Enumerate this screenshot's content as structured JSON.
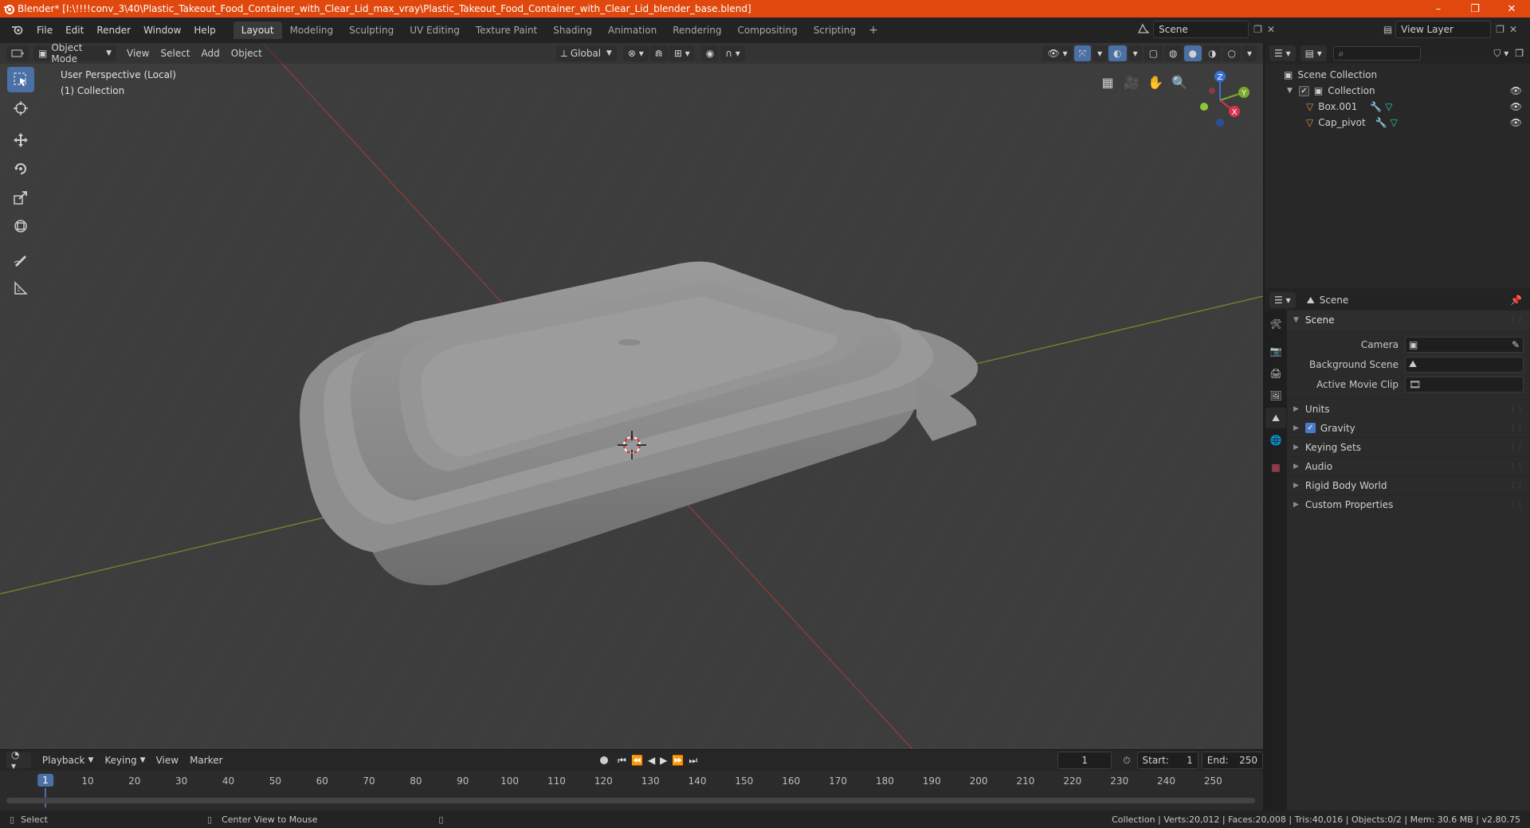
{
  "window": {
    "title": "Blender* [I:\\!!!!conv_3\\40\\Plastic_Takeout_Food_Container_with_Clear_Lid_max_vray\\Plastic_Takeout_Food_Container_with_Clear_Lid_blender_base.blend]",
    "controls": [
      "–",
      "❐",
      "✕"
    ]
  },
  "menu": [
    "File",
    "Edit",
    "Render",
    "Window",
    "Help"
  ],
  "workspaces": [
    "Layout",
    "Modeling",
    "Sculpting",
    "UV Editing",
    "Texture Paint",
    "Shading",
    "Animation",
    "Rendering",
    "Compositing",
    "Scripting"
  ],
  "active_workspace": "Layout",
  "scene_selector": "Scene",
  "view_layer_selector": "View Layer",
  "viewport": {
    "mode": "Object Mode",
    "menus": [
      "View",
      "Select",
      "Add",
      "Object"
    ],
    "transform_orientation": "Global",
    "info_line1": "User Perspective (Local)",
    "info_line2": "(1) Collection"
  },
  "gizmo": {
    "z": "Z",
    "y": "Y",
    "x": "X"
  },
  "timeline": {
    "menus": [
      "Playback",
      "Keying",
      "View",
      "Marker"
    ],
    "current_frame": "1",
    "start_label": "Start:",
    "start": "1",
    "end_label": "End:",
    "end": "250",
    "ticks": [
      "1",
      "10",
      "20",
      "30",
      "40",
      "50",
      "60",
      "70",
      "80",
      "90",
      "100",
      "110",
      "120",
      "130",
      "140",
      "150",
      "160",
      "170",
      "180",
      "190",
      "200",
      "210",
      "220",
      "230",
      "240",
      "250"
    ]
  },
  "statusbar": {
    "left_action": "Select",
    "middle_action": "Center View to Mouse",
    "stats": "Collection | Verts:20,012 | Faces:20,008 | Tris:40,016 | Objects:0/2 | Mem: 30.6 MB | v2.80.75"
  },
  "outliner": {
    "root": "Scene Collection",
    "collection": "Collection",
    "objects": [
      "Box.001",
      "Cap_pivot"
    ]
  },
  "properties": {
    "header": "Scene",
    "panel": "Scene",
    "rows": [
      {
        "label": "Camera"
      },
      {
        "label": "Background Scene"
      },
      {
        "label": "Active Movie Clip"
      }
    ],
    "subpanels": [
      "Units",
      "Gravity",
      "Keying Sets",
      "Audio",
      "Rigid Body World",
      "Custom Properties"
    ]
  }
}
